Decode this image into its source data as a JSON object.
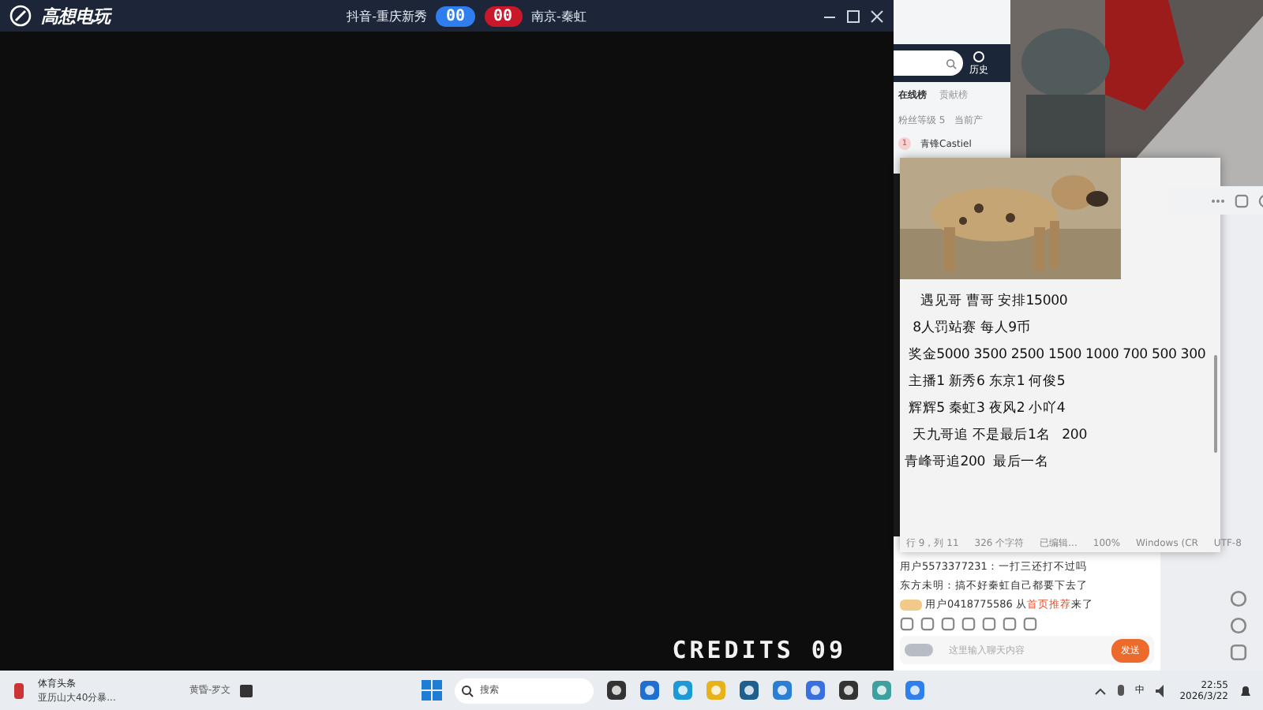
{
  "emulator": {
    "logo": "高想电玩",
    "left_player": "抖音-重庆新秀",
    "left_score": "00",
    "right_score": "00",
    "right_player": "南京-秦虹",
    "credits": "CREDITS 09"
  },
  "live_panel": {
    "history": "历史",
    "tabs": [
      {
        "label": "在线榜",
        "selected": true
      },
      {
        "label": "贡献榜",
        "selected": false
      }
    ],
    "fan_level": "粉丝等级 5",
    "column_2": "当前产",
    "viewer": {
      "rank": "1",
      "name": "青锋Castiel"
    }
  },
  "notepad": {
    "lines": [
      "    遇见哥 曹哥 安排15000",
      "  8人罚站赛 每人9币",
      " 奖金5000 3500 2500 1500 1000 700 500 300",
      " 主播1 新秀6 东京1 何俊5",
      " 辉辉5 秦虹3 夜风2 小吖4",
      "  天九哥追 不是最后1名   200",
      "青峰哥追200  最后一名"
    ],
    "status": [
      "行 9，列 11",
      "326 个字符",
      "已编辑...",
      "100%",
      "Windows (CR",
      "UTF-8"
    ]
  },
  "chat": {
    "messages": [
      {
        "kind": "comment",
        "user": "用户5573377231：",
        "text": "一打三还打不过吗"
      },
      {
        "kind": "comment",
        "user": "东方未明：",
        "text": "搞不好秦虹自己都要下去了"
      },
      {
        "kind": "entry",
        "user": "用户0418775586",
        "pre": " 从",
        "link": "首页推荐",
        "post": "来了"
      }
    ],
    "placeholder": "这里输入聊天内容",
    "send": "发送"
  },
  "taskbar": {
    "news_title": "体育头条",
    "news_text": "亚历山大40分暴...",
    "media": "黄昏-罗文",
    "search_placeholder": "搜索",
    "ime": "中",
    "time": "22:55",
    "date": "2026/3/22"
  }
}
